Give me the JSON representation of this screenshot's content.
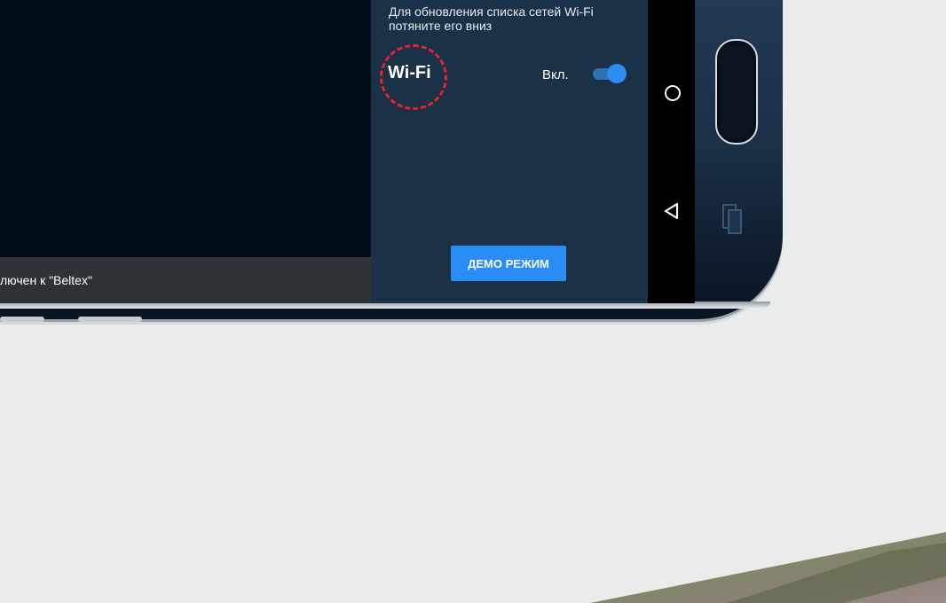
{
  "panel": {
    "hint": "Для обновления списка сетей Wi-Fi потяните его вниз",
    "wifi_label": "Wi-Fi",
    "toggle_state_label": "Вкл.",
    "toggle_on": true,
    "demo_button": "ДЕМО РЕЖИМ"
  },
  "snackbar": {
    "text": "лючен к \"Beltex\""
  },
  "navigation": {
    "home": "home-icon",
    "back": "back-icon",
    "recents": "recents-icon"
  },
  "colors": {
    "panel_bg": "#1a3147",
    "accent": "#2a8cf5",
    "highlight_circle": "#e4252b",
    "page_bg": "#eaeceb"
  }
}
